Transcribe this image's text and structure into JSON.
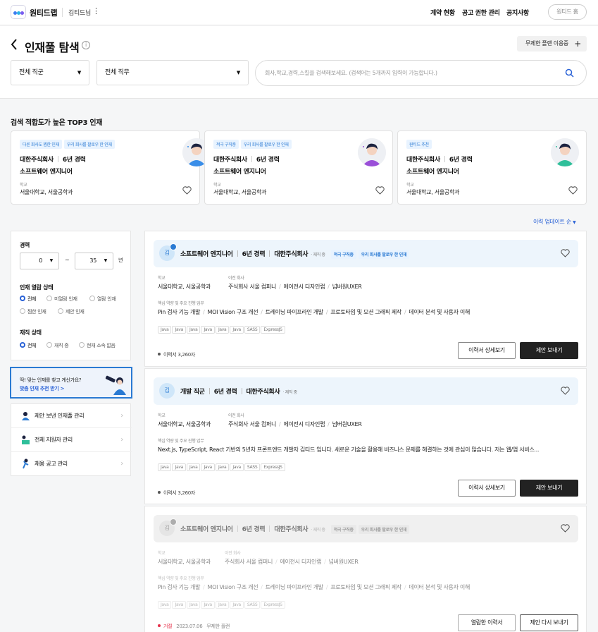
{
  "header": {
    "brand": "원티드랩",
    "user": "김티드님",
    "nav": [
      "계약 현황",
      "공고 권한 관리",
      "공지사항"
    ],
    "home_button": "원티드 홈"
  },
  "page": {
    "title": "인재풀 탐색",
    "plan_button": "무제한 플랜 이용중",
    "job_group": "전체 직군",
    "job_role": "전체 직무",
    "search_placeholder": "회사,학교,경력,스킬을 검색해보세요. (검색어는 5개까지 입력이 가능합니다.)"
  },
  "top3": {
    "title": "검색 적합도가 높은 TOP3 인재",
    "cards": [
      {
        "tags": [
          "다른 회사도 찜한 인재",
          "우리 회사를 팔로우 한 인재"
        ],
        "company": "대한주식회사",
        "years": "6년 경력",
        "role": "소프트웨어 엔지니어",
        "school_label": "학교",
        "school": "서울대학교, 서울공학과"
      },
      {
        "tags": [
          "적극 구직중",
          "우리 회사를 팔로우 한 인재"
        ],
        "company": "대한주식회사",
        "years": "6년 경력",
        "role": "소프트웨어 엔지니어",
        "school_label": "학교",
        "school": "서울대학교, 서울공학과"
      },
      {
        "tags": [
          "원티드 추천"
        ],
        "company": "대한주식회사",
        "years": "6년 경력",
        "role": "소프트웨어 엔지니어",
        "school_label": "학교",
        "school": "서울대학교, 서울공학과"
      }
    ]
  },
  "sort": "이력 업데이트 순",
  "filters": {
    "career_label": "경력",
    "career_min": "0",
    "career_max": "35",
    "career_unit": "년",
    "career_tilde": "~",
    "view_status_label": "인재 열람 상태",
    "view_status": [
      "전체",
      "미열람 인재",
      "열람 인재",
      "찜한 인재",
      "제안 인재"
    ],
    "employ_label": "재직 상태",
    "employ_status": [
      "전체",
      "재직 중",
      "현재 소속 없음"
    ]
  },
  "promo": {
    "line1": "딱! 맞는 인재를 찾고 계신가요?",
    "line2": "맞춤 인재 추천 받기 >"
  },
  "links": [
    "제안 보낸 인재풀 관리",
    "전체 지원자 관리",
    "채용 공고 관리"
  ],
  "candidates": [
    {
      "avatar": "김",
      "title": "소프트웨어 엔지니어",
      "years": "6년 경력",
      "company": "대한주식회사",
      "status": "· 재직 중",
      "tags": [
        "적극 구직중",
        "우리 회사를 팔로우 한 인재"
      ],
      "school_label": "학교",
      "school": "서울대학교, 서울공학과",
      "prev_label": "이전 회사",
      "prev": [
        "주식회사 서울 컴퍼니",
        "에이전시 디자인랩",
        "넘버원UXER"
      ],
      "work_label": "핵심 역량 및 주요 진행 업무",
      "work": [
        "Pin 검사 기능 개발",
        "MOI Vision 구조 개선",
        "트레이닝 파이프라인 개발",
        "프로토타입 및 모션 그래픽 제작",
        "데이터 분석 및 사용자 이해"
      ],
      "skills": [
        "Java",
        "Java",
        "Java",
        "Java",
        "Java",
        "Java",
        "SASS",
        "ExpressJS"
      ],
      "views": "이력서 3,260자",
      "btn1": "이력서 상세보기",
      "btn2": "제안 보내기"
    },
    {
      "avatar": "김",
      "title": "개발 직군",
      "years": "6년 경력",
      "company": "대한주식회사",
      "status": "· 재직 중",
      "school_label": "학교",
      "school": "서울대학교, 서울공학과",
      "prev_label": "이전 회사",
      "prev": [
        "주식회사 서울 컴퍼니",
        "에이전시 디자인랩",
        "넘버원UXER"
      ],
      "work_label": "핵심 역량 및 주요 진행 업무",
      "work_text": "Next.js, TypeScript, React 기반의 5년차 프론트엔드 개발자 김티드 입니다. 새로운 기술을 활용해 비즈니스 문제를 해결하는 것에 관심이 많습니다. 저는 웹/앱 서비스...",
      "skills": [
        "Java",
        "Java",
        "Java",
        "Java",
        "Java",
        "Java",
        "SASS",
        "ExpressJS"
      ],
      "views": "이력서 3,260자",
      "btn1": "이력서 상세보기",
      "btn2": "제안 보내기"
    },
    {
      "avatar": "김",
      "title": "소프트웨어 엔지니어",
      "years": "6년 경력",
      "company": "대한주식회사",
      "status": "· 재직 중",
      "tags": [
        "적극 구직중",
        "우리 회사를 팔로우 한 인재"
      ],
      "school_label": "학교",
      "school": "서울대학교, 서울공학과",
      "prev_label": "이전 회사",
      "prev": [
        "주식회사 서울 컴퍼니",
        "에이전시 디자인랩",
        "넘버원UXER"
      ],
      "work_label": "핵심 역량 및 주요 진행 업무",
      "work": [
        "Pin 검사 기능 개발",
        "MOI Vision 구조 개선",
        "트레이닝 파이프라인 개발",
        "프로토타입 및 모션 그래픽 제작",
        "데이터 분석 및 사용자 이해"
      ],
      "skills": [
        "Java",
        "Java",
        "Java",
        "Java",
        "Java",
        "Java",
        "SASS",
        "ExpressJS"
      ],
      "rejected": "거절",
      "date": "2023.07.06",
      "plan": "무제한 플랜",
      "btn1": "열람한 이력서",
      "btn2": "제안 다시 보내기"
    }
  ],
  "colors": {
    "accent": "#2a62d6",
    "tag_bg": "#e8f3ff",
    "card_head_bg": "#edf5fc",
    "dark_button": "#222222",
    "rejected": "#e5304a"
  }
}
